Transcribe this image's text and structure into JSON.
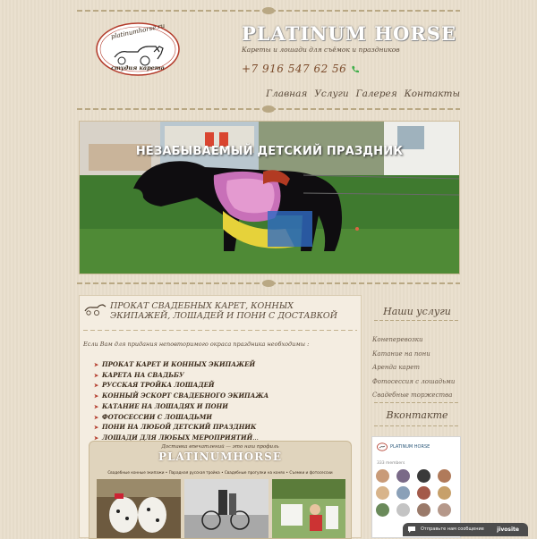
{
  "header": {
    "logo_text_top": "platinumhorse.ru",
    "logo_text_bottom": "студия карета",
    "brand": "PLATINUM HORSE",
    "tagline": "Кареты и лошади для съёмок и праздников",
    "phone": "+7 916 547 62 56"
  },
  "nav": {
    "items": [
      "Главная",
      "Услуги",
      "Галерея",
      "Контакты"
    ]
  },
  "banner": {
    "title": "НЕЗАБЫВАЕМЫЙ ДЕТСКИЙ ПРАЗДНИК"
  },
  "main": {
    "title": "ПРОКАТ СВАДЕБНЫХ КАРЕТ, КОННЫХ ЭКИПАЖЕЙ, ЛОШАДЕЙ И ПОНИ С ДОСТАВКОЙ",
    "intro": "Если Вам для придания неповторимого окраса праздника необходимы :",
    "services": [
      "ПРОКАТ КАРЕТ И КОННЫХ ЭКИПАЖЕЙ",
      "КАРЕТА НА СВАДЬБУ",
      "РУССКАЯ ТРОЙКА ЛОШАДЕЙ",
      "КОННЫЙ ЭСКОРТ СВАДЕБНОГО ЭКИПАЖА",
      "КАТАНИЕ НА ЛОШАДЯХ И ПОНИ",
      "ФОТОСЕССИИ С ЛОШАДЬМИ",
      "ПОНИ НА ЛЮБОЙ ДЕТСКИЙ ПРАЗДНИК",
      "ЛОШАДИ ДЛЯ ЛЮБЫХ МЕРОПРИЯТИЙ"
    ],
    "services_ellipsis": "...",
    "promo": {
      "subtitle": "Доставка впечатлений — это наш профиль",
      "brand": "PLATINUMHORSE",
      "links": "Свадебные конные экипажи  •  Парадная русская тройка  •  Свадебные прогулки на конях  •  Съемки и фотосессии"
    }
  },
  "sidebar": {
    "services_title": "Наши услуги",
    "services": [
      "Конеперевозки",
      "Катание на пони",
      "Аренда карет",
      "Фотосессия с лошадьми",
      "Свадебные торжества"
    ],
    "vk_title": "Вконтакте",
    "vk": {
      "group_name": "PLATINUM HORSE",
      "members": "333 members"
    }
  },
  "chat": {
    "label": "Отправьте нам сообщение",
    "logo": "jivosite"
  },
  "colors": {
    "background": "#e9decc",
    "accent_red": "#b33a2a",
    "vk_blue": "#2b587a"
  }
}
